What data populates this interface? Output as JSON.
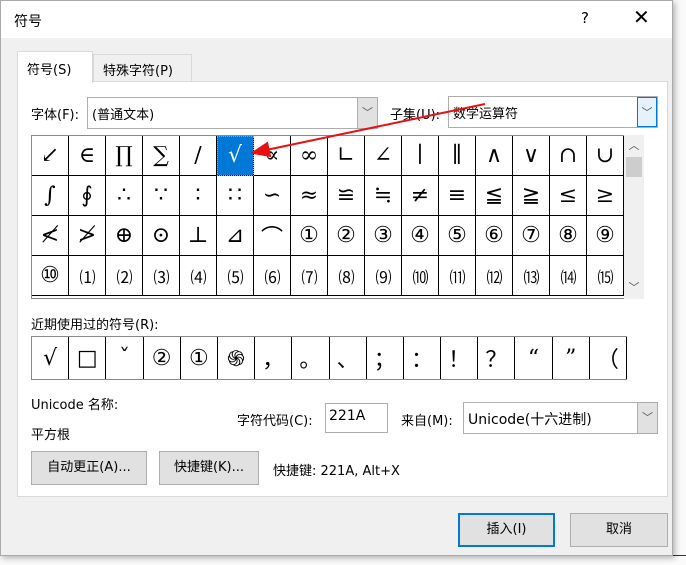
{
  "dialog": {
    "title": "符号",
    "help": "?",
    "close": "✕"
  },
  "tabs": [
    {
      "label": "符号(S)"
    },
    {
      "label": "特殊字符(P)"
    }
  ],
  "font": {
    "label": "字体(F):",
    "value": "(普通文本)"
  },
  "subset": {
    "label": "子集(U):",
    "value": "数学运算符"
  },
  "symbols": [
    "↙",
    "∈",
    "∏",
    "∑",
    "∕",
    "√",
    "∝",
    "∞",
    "∟",
    "∠",
    "∣",
    "∥",
    "∧",
    "∨",
    "∩",
    "∪",
    "∫",
    "∮",
    "∴",
    "∵",
    "∶",
    "∷",
    "∽",
    "≈",
    "≌",
    "≒",
    "≠",
    "≡",
    "≦",
    "≧",
    "≤",
    "≥",
    "≮",
    "≯",
    "⊕",
    "⊙",
    "⊥",
    "⊿",
    "⌒",
    "①",
    "②",
    "③",
    "④",
    "⑤",
    "⑥",
    "⑦",
    "⑧",
    "⑨",
    "⑩",
    "⑴",
    "⑵",
    "⑶",
    "⑷",
    "⑸",
    "⑹",
    "⑺",
    "⑻",
    "⑼",
    "⑽",
    "⑾",
    "⑿",
    "⒀",
    "⒁",
    "⒂"
  ],
  "selected_index": 5,
  "recent": {
    "label": "近期使用过的符号(R):",
    "items": [
      "√",
      "□",
      "ˇ",
      "②",
      "①",
      "֍",
      "，",
      "。",
      "、",
      "；",
      "：",
      "！",
      "？",
      "“",
      "”",
      "（"
    ]
  },
  "unicode_name": {
    "label": "Unicode 名称:",
    "value": "平方根"
  },
  "char_code": {
    "label": "字符代码(C):",
    "value": "221A"
  },
  "from": {
    "label": "来自(M):",
    "value": "Unicode(十六进制)"
  },
  "buttons": {
    "autocorrect": "自动更正(A)...",
    "shortcut_key": "快捷键(K)...",
    "insert": "插入(I)",
    "cancel": "取消"
  },
  "shortcut_text": "快捷键: 221A, Alt+X",
  "colors": {
    "accent": "#0078d7",
    "arrow": "#e81010"
  }
}
